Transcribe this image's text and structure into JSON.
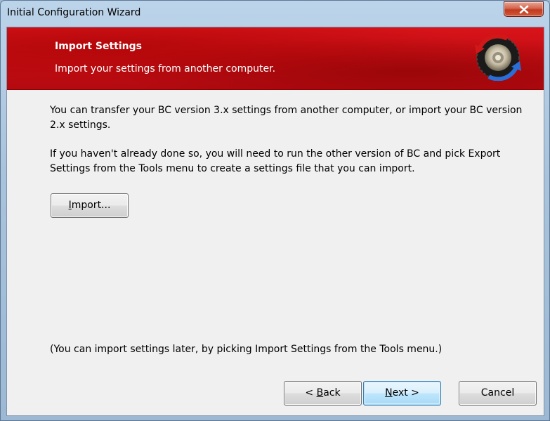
{
  "window": {
    "title": "Initial Configuration Wizard"
  },
  "banner": {
    "title": "Import Settings",
    "subtitle": "Import your settings from another computer."
  },
  "content": {
    "paragraph1": "You can transfer your BC version 3.x settings from another computer, or import your BC version 2.x settings.",
    "paragraph2": "If you haven't already done so, you will need to run the other version of BC and pick Export Settings from the Tools menu to create a settings file that you can import.",
    "note": "(You can import settings later, by picking Import Settings from the Tools menu.)"
  },
  "buttons": {
    "import": {
      "mnemonic": "I",
      "rest": "mport..."
    },
    "back": {
      "prefix": "< ",
      "mnemonic": "B",
      "rest": "ack"
    },
    "next": {
      "mnemonic": "N",
      "rest": "ext >"
    },
    "cancel": "Cancel"
  },
  "colors": {
    "banner_red": "#c60e14",
    "dialog_bg": "#f0f0f0",
    "close_button_red": "#c23a1f",
    "default_button_border": "#3c7fb1"
  },
  "icons": {
    "close": "close-icon",
    "logo": "beyond-compare-logo-icon"
  }
}
